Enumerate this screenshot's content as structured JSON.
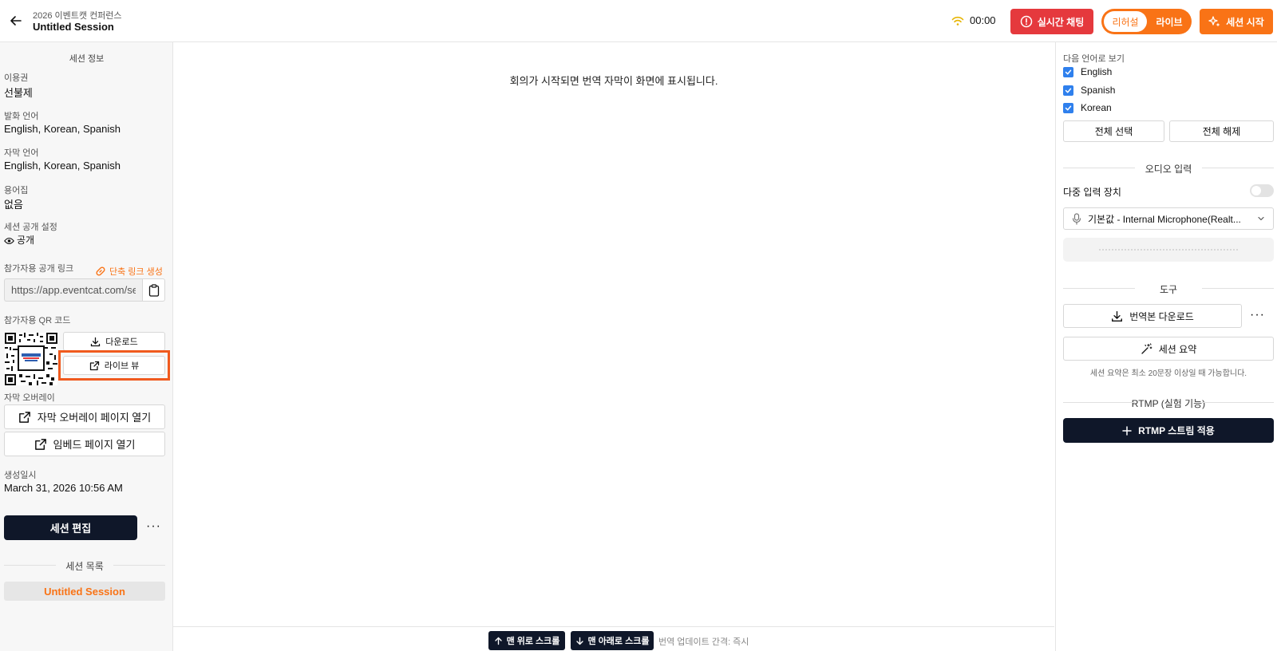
{
  "header": {
    "event_name": "2026 이벤트캣 컨퍼런스",
    "session_title": "Untitled Session",
    "timer": "00:00",
    "chat_label": "실시간 채팅",
    "mode_rehearsal": "리허설",
    "mode_live": "라이브",
    "start_label": "세션 시작"
  },
  "colors": {
    "accent": "#f97316",
    "danger": "#e5393d",
    "dark": "#0f1729",
    "checkbox": "#2f80ed"
  },
  "left": {
    "section_title": "세션 정보",
    "plan_label": "이용권",
    "plan_value": "선불제",
    "speech_lang_label": "발화 언어",
    "speech_lang_value": "English, Korean, Spanish",
    "subtitle_lang_label": "자막 언어",
    "subtitle_lang_value": "English, Korean, Spanish",
    "glossary_label": "용어집",
    "glossary_value": "없음",
    "visibility_label": "세션 공개 설정",
    "visibility_value": "공개",
    "public_link_label": "참가자용 공개 링크",
    "shortlink_label": "단축 링크 생성",
    "public_link_value": "https://app.eventcat.com/se",
    "qr_label": "참가자용 QR 코드",
    "download_label": "다운로드",
    "liveview_label": "라이브 뷰",
    "overlay_label": "자막 오버레이",
    "overlay_open_label": "자막 오버레이 페이지 열기",
    "embed_open_label": "임베드 페이지 열기",
    "created_label": "생성일시",
    "created_value": "March 31, 2026 10:56 AM",
    "edit_label": "세션 편집",
    "more": "···",
    "session_list_title": "세션 목록",
    "session_item": "Untitled Session"
  },
  "main": {
    "placeholder_message": "회의가 시작되면 번역 자막이 화면에 표시됩니다.",
    "scroll_top_label": "맨 위로 스크롤",
    "scroll_bottom_label": "맨 아래로 스크롤",
    "interval_text": "번역 업데이트 간격: 즉시"
  },
  "right": {
    "view_lang_label": "다음 언어로 보기",
    "languages": [
      {
        "label": "English",
        "checked": true
      },
      {
        "label": "Spanish",
        "checked": true
      },
      {
        "label": "Korean",
        "checked": true
      }
    ],
    "select_all_label": "전체 선택",
    "deselect_all_label": "전체 해제",
    "audio_title": "오디오 입력",
    "multi_input_label": "다중 입력 장치",
    "device_value": "기본값 - Internal Microphone(Realt...",
    "tools_title": "도구",
    "download_translation_label": "번역본 다운로드",
    "more": "···",
    "summary_label": "세션 요약",
    "summary_note": "세션 요약은 최소 20문장 이상일 때 가능합니다.",
    "rtmp_title": "RTMP (실험 기능)",
    "rtmp_button_label": "RTMP 스트림 적용"
  }
}
